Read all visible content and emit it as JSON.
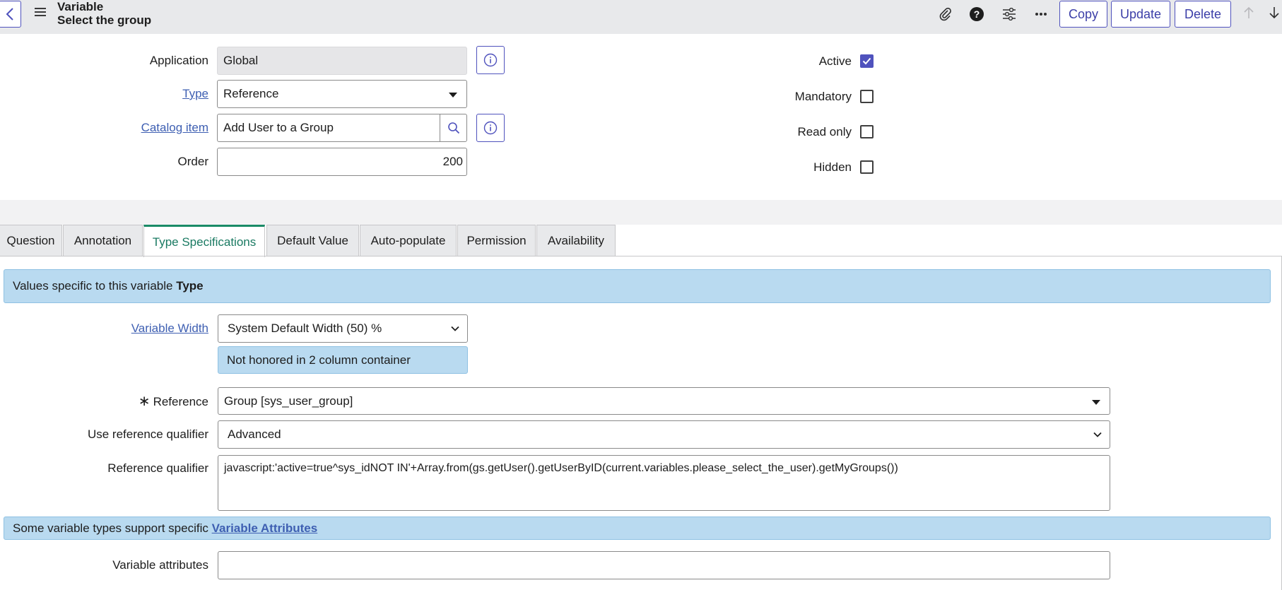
{
  "header": {
    "title": "Variable",
    "subtitle": "Select the group",
    "buttons": {
      "copy": "Copy",
      "update": "Update",
      "delete": "Delete"
    }
  },
  "form": {
    "application": {
      "label": "Application",
      "value": "Global"
    },
    "type": {
      "label": "Type",
      "value": "Reference"
    },
    "catalog_item": {
      "label": "Catalog item",
      "value": "Add User to a Group"
    },
    "order": {
      "label": "Order",
      "value": "200"
    },
    "active": {
      "label": "Active",
      "checked": true
    },
    "mandatory": {
      "label": "Mandatory",
      "checked": false
    },
    "read_only": {
      "label": "Read only",
      "checked": false
    },
    "hidden": {
      "label": "Hidden",
      "checked": false
    }
  },
  "tabs": [
    {
      "label": "Question"
    },
    {
      "label": "Annotation"
    },
    {
      "label": "Type Specifications",
      "active": true
    },
    {
      "label": "Default Value"
    },
    {
      "label": "Auto-populate"
    },
    {
      "label": "Permission"
    },
    {
      "label": "Availability"
    }
  ],
  "type_spec": {
    "banner_text": "Values specific to this variable",
    "banner_bold": "Type",
    "variable_width": {
      "label": "Variable Width",
      "value": "System Default Width (50) %"
    },
    "width_note": "Not honored in 2 column container",
    "reference": {
      "label": "Reference",
      "required_mark": "∗",
      "value": "Group [sys_user_group]"
    },
    "use_ref_qualifier": {
      "label": "Use reference qualifier",
      "value": "Advanced"
    },
    "ref_qualifier": {
      "label": "Reference qualifier",
      "value": "javascript:'active=true^sys_idNOT IN'+Array.from(gs.getUser().getUserByID(current.variables.please_select_the_user).getMyGroups())"
    },
    "attributes_note_text": "Some variable types support specific",
    "attributes_note_link": "Variable Attributes",
    "variable_attributes": {
      "label": "Variable attributes",
      "value": ""
    }
  },
  "colors": {
    "accent": "#4f52bd",
    "tab_active": "#1a8b66",
    "note_bg": "#b9daf0",
    "link": "#3e5fb2"
  }
}
